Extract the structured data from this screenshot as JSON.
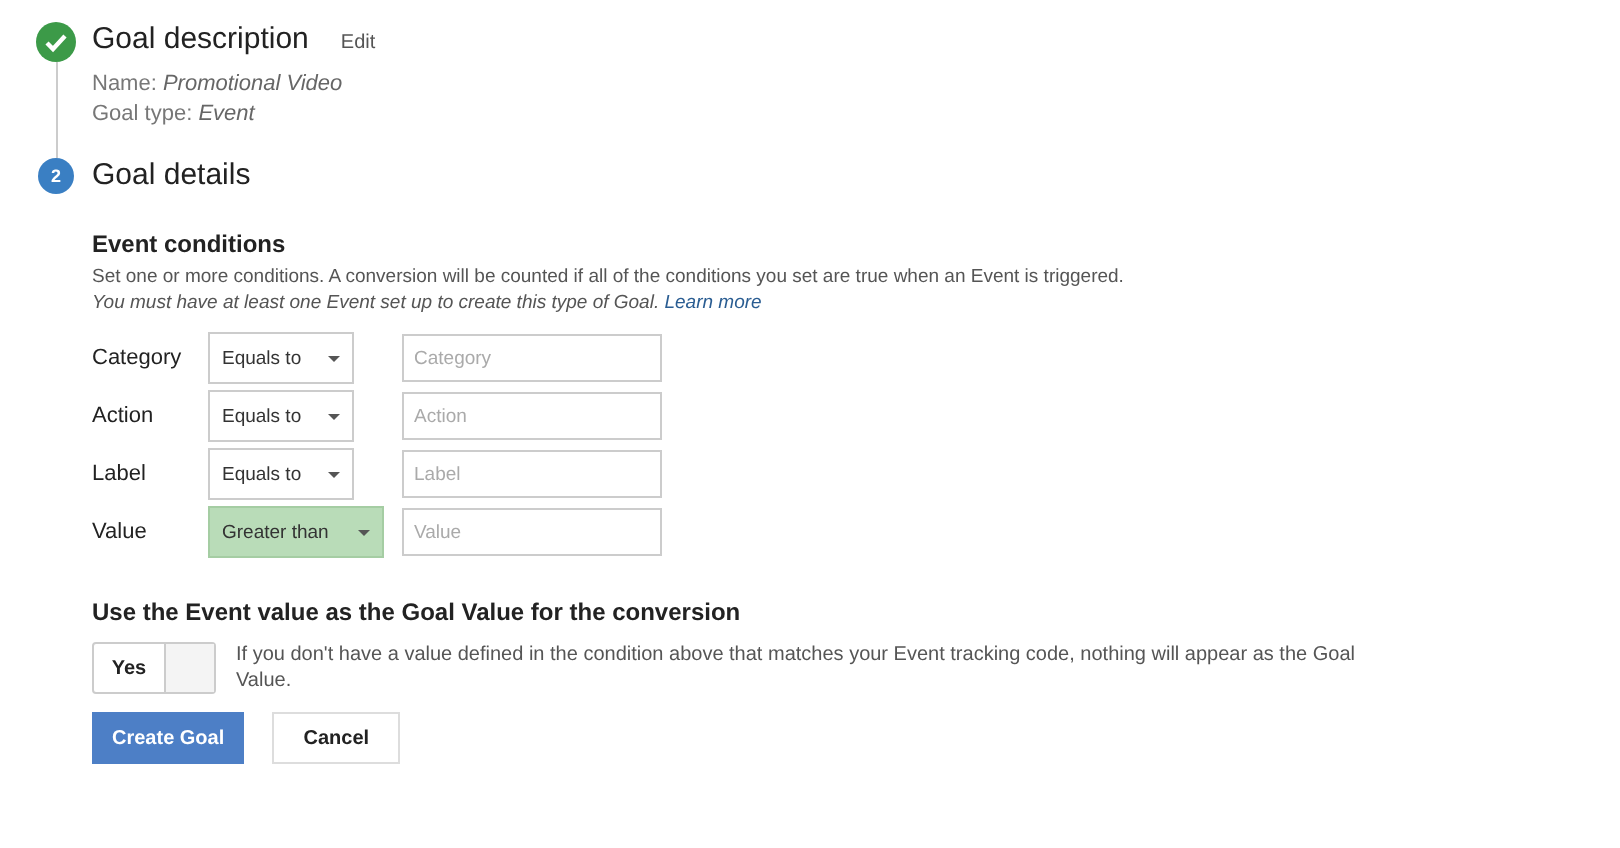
{
  "steps": [
    {
      "kind": "done",
      "title": "Goal description",
      "action": "Edit",
      "details": [
        {
          "label": "Name: ",
          "value": "Promotional Video"
        },
        {
          "label": "Goal type: ",
          "value": "Event"
        }
      ]
    },
    {
      "kind": "current",
      "number": "2",
      "title": "Goal details"
    }
  ],
  "event_conditions": {
    "heading": "Event conditions",
    "description": "Set one or more conditions. A conversion will be counted if all of the conditions you set are true when an Event is triggered.",
    "note": "You must have at least one Event set up to create this type of Goal.",
    "link": "Learn more",
    "rows": [
      {
        "label": "Category",
        "operator": "Equals to",
        "highlighted": false,
        "placeholder": "Category"
      },
      {
        "label": "Action",
        "operator": "Equals to",
        "highlighted": false,
        "placeholder": "Action"
      },
      {
        "label": "Label",
        "operator": "Equals to",
        "highlighted": false,
        "placeholder": "Label"
      },
      {
        "label": "Value",
        "operator": "Greater than",
        "highlighted": true,
        "placeholder": "Value"
      }
    ]
  },
  "goal_value": {
    "heading": "Use the Event value as the Goal Value for the conversion",
    "toggle": {
      "label": "Yes",
      "on": true
    },
    "help": "If you don't have a value defined in the condition above that matches your Event tracking code, nothing will appear as the Goal Value."
  },
  "buttons": [
    {
      "kind": "primary",
      "label": "Create Goal"
    },
    {
      "kind": "secondary",
      "label": "Cancel"
    }
  ]
}
